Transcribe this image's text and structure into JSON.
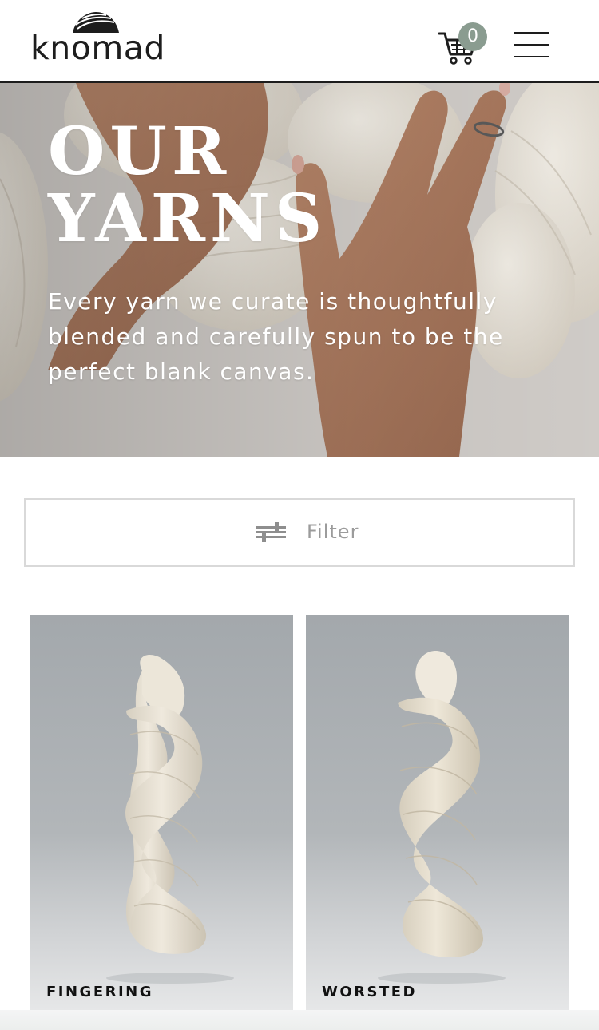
{
  "header": {
    "logo_text": "knomad",
    "cart_count": "0",
    "icons": {
      "cart": "shopping-cart-icon",
      "menu": "hamburger-menu-icon",
      "logo": "yarn-skein-logo-icon"
    }
  },
  "hero": {
    "title": "OUR YARNS",
    "description": "Every yarn we curate is thoughtfully blended and carefully spun to be the perfect blank canvas."
  },
  "filter": {
    "label": "Filter",
    "icon": "sliders-icon"
  },
  "products": [
    {
      "label": "FINGERING"
    },
    {
      "label": "WORSTED"
    }
  ],
  "colors": {
    "text_dark": "#1d1d1d",
    "cart_badge": "#8a9c90",
    "filter_text": "#9b9b9b",
    "yarn": "#e8e2d6",
    "product_bg": "#a3a8ac"
  }
}
